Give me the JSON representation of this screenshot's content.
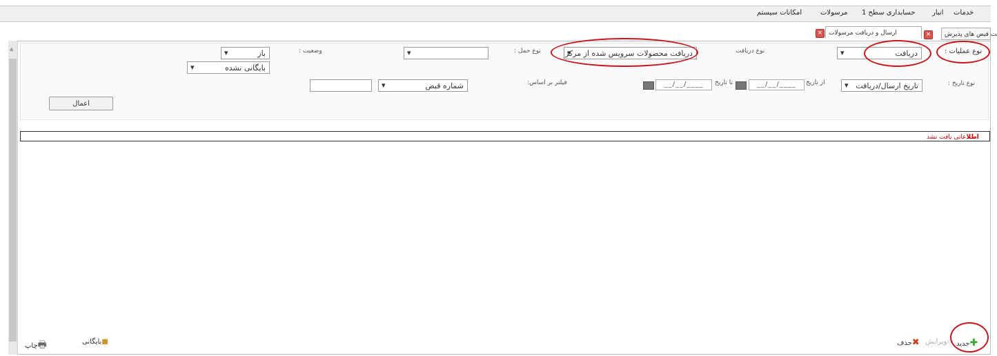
{
  "menu": {
    "items": [
      "خدمات",
      "انبار",
      "حسابداری سطح 1",
      "مرسولات",
      "امکانات سیستم"
    ]
  },
  "tabs": [
    {
      "label": "لیست قبض های پذیرش"
    },
    {
      "label": "ارسال و دریافت مرسولات"
    }
  ],
  "filters": {
    "operation_type_label": "نوع عملیات :",
    "operation_type_value": "دریافت",
    "receive_type_label": "نوع دریافت",
    "receive_type_value": "دریافت محصولات سرویس شده از مرکز",
    "transport_type_label": "نوع حمل :",
    "transport_type_value": "",
    "status_label": "وضعیت :",
    "status_value": "باز",
    "archive_value": "بایگانی نشده",
    "date_type_label": "نوع تاریخ :",
    "date_type_value": "تاریخ ارسال/دریافت",
    "from_date_label": "از تاریخ",
    "to_date_label": "تا تاریخ",
    "date_placeholder": "__/__/____",
    "filter_by_label": "فیلتر بر اساس:",
    "filter_by_value": "شماره قبض",
    "filter_text_value": "",
    "apply_label": "اعمال"
  },
  "result": {
    "message_bold": "اطلا",
    "message": "عاتی یافت نشد"
  },
  "toolbar": {
    "new_label": "جدید",
    "edit_label": "ویرایش",
    "delete_label": "حذف",
    "archive_label": "بایگانی",
    "print_label": "چاپ"
  },
  "colors": {
    "annotation": "#c4161c",
    "add": "#3aa335",
    "delete": "#d03a1b"
  }
}
